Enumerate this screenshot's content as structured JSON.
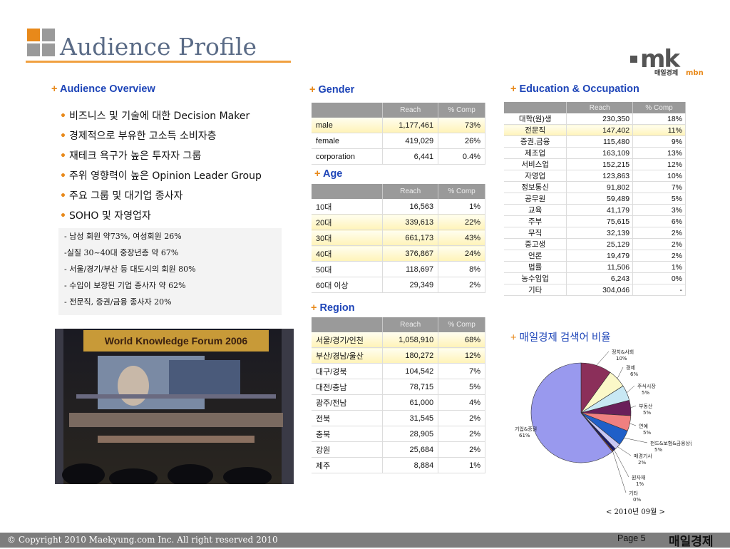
{
  "title": "Audience Profile",
  "brand": {
    "logo_text": "mk",
    "logo_sub": "매일경제",
    "logo_sub2": "mbn",
    "footer_logo": "매일경제"
  },
  "colors": {
    "accent_orange": "#e8891a",
    "section_blue": "#1e45b8",
    "header_gray": "#9a9a9a",
    "title_slate": "#5a6b86"
  },
  "overview": {
    "heading": "Audience Overview",
    "bullets": [
      "비즈니스 및 기술에 대한 Decision Maker",
      "경제적으로 부유한 고소득 소비자층",
      "재테크 욕구가 높은 투자자 그룹",
      "주위 영향력이 높은 Opinion Leader Group",
      "주요 그룹 및 대기업 종사자",
      "SOHO 및 자영업자"
    ],
    "details": [
      "- 남성 회원  약73%, 여성회원 26%",
      "-실질 30~40대 중장년층 약 67%",
      "- 서울/경기/부산 등 대도시의 회원 80%",
      "- 수입이 보장된 기업 종사자 약 62%",
      "- 전문직, 증권/금융 종사자 20%"
    ]
  },
  "photo": {
    "caption": "World Knowledge Forum 2006"
  },
  "gender": {
    "heading": "Gender",
    "columns": [
      "",
      "Reach",
      "% Comp"
    ],
    "rows": [
      {
        "label": "male",
        "reach": "1,177,461",
        "comp": "73%",
        "highlight": true
      },
      {
        "label": "female",
        "reach": "419,029",
        "comp": "26%",
        "highlight": false
      },
      {
        "label": "corporation",
        "reach": "6,441",
        "comp": "0.4%",
        "highlight": false
      }
    ]
  },
  "age": {
    "heading": "Age",
    "columns": [
      "",
      "Reach",
      "% Comp"
    ],
    "rows": [
      {
        "label": "10대",
        "reach": "16,563",
        "comp": "1%",
        "highlight": false
      },
      {
        "label": "20대",
        "reach": "339,613",
        "comp": "22%",
        "highlight": true
      },
      {
        "label": "30대",
        "reach": "661,173",
        "comp": "43%",
        "highlight": true
      },
      {
        "label": "40대",
        "reach": "376,867",
        "comp": "24%",
        "highlight": true
      },
      {
        "label": "50대",
        "reach": "118,697",
        "comp": "8%",
        "highlight": false
      },
      {
        "label": "60대 이상",
        "reach": "29,349",
        "comp": "2%",
        "highlight": false
      }
    ]
  },
  "region": {
    "heading": "Region",
    "columns": [
      "",
      "Reach",
      "% Comp"
    ],
    "rows": [
      {
        "label": "서울/경기/인천",
        "reach": "1,058,910",
        "comp": "68%",
        "highlight": true
      },
      {
        "label": "부산/경남/울산",
        "reach": "180,272",
        "comp": "12%",
        "highlight": true
      },
      {
        "label": "대구/경북",
        "reach": "104,542",
        "comp": "7%",
        "highlight": false
      },
      {
        "label": "대전/충남",
        "reach": "78,715",
        "comp": "5%",
        "highlight": false
      },
      {
        "label": "광주/전남",
        "reach": "61,000",
        "comp": "4%",
        "highlight": false
      },
      {
        "label": "전북",
        "reach": "31,545",
        "comp": "2%",
        "highlight": false
      },
      {
        "label": "충북",
        "reach": "28,905",
        "comp": "2%",
        "highlight": false
      },
      {
        "label": "강원",
        "reach": "25,684",
        "comp": "2%",
        "highlight": false
      },
      {
        "label": "제주",
        "reach": "8,884",
        "comp": "1%",
        "highlight": false
      }
    ]
  },
  "education": {
    "heading": "Education & Occupation",
    "columns": [
      "",
      "Reach",
      "% Comp"
    ],
    "rows": [
      {
        "label": "대학(원)생",
        "reach": "230,350",
        "comp": "18%",
        "highlight": false
      },
      {
        "label": "전문직",
        "reach": "147,402",
        "comp": "11%",
        "highlight": true
      },
      {
        "label": "증권,금융",
        "reach": "115,480",
        "comp": "9%",
        "highlight": false
      },
      {
        "label": "제조업",
        "reach": "163,109",
        "comp": "13%",
        "highlight": false
      },
      {
        "label": "서비스업",
        "reach": "152,215",
        "comp": "12%",
        "highlight": false
      },
      {
        "label": "자영업",
        "reach": "123,863",
        "comp": "10%",
        "highlight": false
      },
      {
        "label": "정보통신",
        "reach": "91,802",
        "comp": "7%",
        "highlight": false
      },
      {
        "label": "공무원",
        "reach": "59,489",
        "comp": "5%",
        "highlight": false
      },
      {
        "label": "교육",
        "reach": "41,179",
        "comp": "3%",
        "highlight": false
      },
      {
        "label": "주부",
        "reach": "75,615",
        "comp": "6%",
        "highlight": false
      },
      {
        "label": "무직",
        "reach": "32,139",
        "comp": "2%",
        "highlight": false
      },
      {
        "label": "중고생",
        "reach": "25,129",
        "comp": "2%",
        "highlight": false
      },
      {
        "label": "언론",
        "reach": "19,479",
        "comp": "2%",
        "highlight": false
      },
      {
        "label": "법률",
        "reach": "11,506",
        "comp": "1%",
        "highlight": false
      },
      {
        "label": "농수임업",
        "reach": "6,243",
        "comp": "0%",
        "highlight": false
      },
      {
        "label": "기타",
        "reach": "304,046",
        "comp": "-",
        "highlight": false
      }
    ]
  },
  "search_ratio": {
    "heading": "매일경제 검색어 비율",
    "date_note": "< 2010년 09월 >"
  },
  "chart_data": {
    "type": "pie",
    "title": "",
    "slices": [
      {
        "name": "정치&사회",
        "value": 10,
        "label": "10%",
        "color": "#8b2f5a"
      },
      {
        "name": "경제",
        "value": 6,
        "label": "6%",
        "color": "#fbf8c8"
      },
      {
        "name": "주식시장",
        "value": 5,
        "label": "5%",
        "color": "#c8e8f4"
      },
      {
        "name": "부동산",
        "value": 5,
        "label": "5%",
        "color": "#6a1f5a"
      },
      {
        "name": "연예",
        "value": 5,
        "label": "5%",
        "color": "#f08080"
      },
      {
        "name": "펀드&보험&금융상품",
        "value": 5,
        "label": "5%",
        "color": "#1f5fc8"
      },
      {
        "name": "매경기사",
        "value": 2,
        "label": "2%",
        "color": "#c8c8f4"
      },
      {
        "name": "원자재",
        "value": 1,
        "label": "1%",
        "color": "#1a1a6a"
      },
      {
        "name": "기타",
        "value": 0,
        "label": "0%",
        "color": "#f07020"
      },
      {
        "name": "기업&증권",
        "value": 61,
        "label": "61%",
        "color": "#9999ee"
      }
    ]
  },
  "footer": {
    "copyright": "© Copyright 2010 Maekyung.com Inc. All right reserved 2010",
    "page": "Page 5"
  }
}
